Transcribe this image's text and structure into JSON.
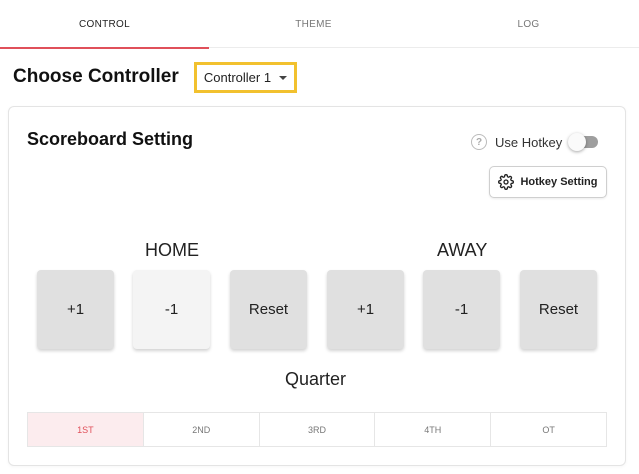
{
  "tabs": [
    {
      "label": "CONTROL",
      "active": true
    },
    {
      "label": "THEME",
      "active": false
    },
    {
      "label": "LOG",
      "active": false
    }
  ],
  "header": {
    "title": "Choose Controller",
    "controller_value": "Controller 1"
  },
  "scoreboard": {
    "title": "Scoreboard Setting",
    "use_hotkey_label": "Use Hotkey",
    "use_hotkey_on": false,
    "hotkey_setting_label": "Hotkey Setting",
    "home": {
      "label": "HOME",
      "buttons": [
        "+1",
        "-1",
        "Reset"
      ]
    },
    "away": {
      "label": "AWAY",
      "buttons": [
        "+1",
        "-1",
        "Reset"
      ]
    },
    "quarter_label": "Quarter",
    "quarters": [
      "1ST",
      "2ND",
      "3RD",
      "4TH",
      "OT"
    ],
    "active_quarter": "1ST"
  },
  "icons": {
    "help": "question-circle-icon",
    "gear": "gear-icon",
    "dropdown": "caret-down-icon"
  },
  "colors": {
    "accent": "#e0505a",
    "highlight_border": "#f2c12e",
    "active_quarter_bg": "#fcecee"
  }
}
